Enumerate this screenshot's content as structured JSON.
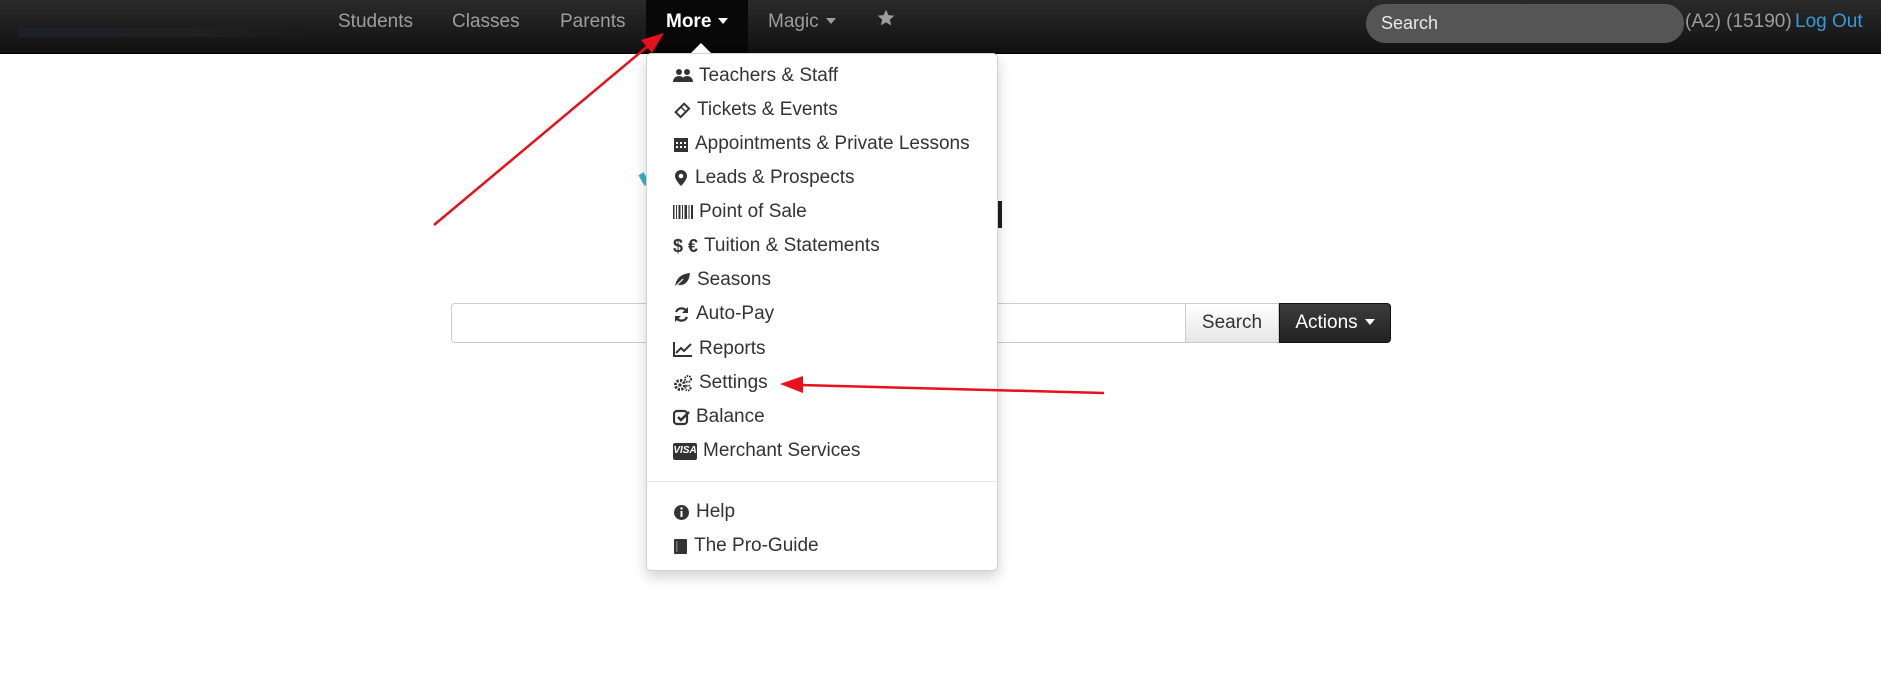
{
  "navbar": {
    "links": [
      {
        "label": "Students"
      },
      {
        "label": "Classes"
      },
      {
        "label": "Parents"
      }
    ],
    "more_label": "More",
    "magic_label": "Magic",
    "search_placeholder": "Search",
    "account_text": "(A2) (15190)",
    "logout_label": "Log Out"
  },
  "main": {
    "search_value": "",
    "search_button": "Search",
    "actions_button": "Actions"
  },
  "dropdown": {
    "items": [
      {
        "label": "Teachers & Staff",
        "icon": "users-icon"
      },
      {
        "label": "Tickets & Events",
        "icon": "ticket-icon"
      },
      {
        "label": "Appointments & Private Lessons",
        "icon": "calendar-icon"
      },
      {
        "label": "Leads & Prospects",
        "icon": "map-marker-icon"
      },
      {
        "label": "Point of Sale",
        "icon": "barcode-icon"
      },
      {
        "label": "Tuition & Statements",
        "icon": "dollar-euro-icon"
      },
      {
        "label": "Seasons",
        "icon": "leaf-icon"
      },
      {
        "label": "Auto-Pay",
        "icon": "refresh-icon"
      },
      {
        "label": "Reports",
        "icon": "line-chart-icon"
      },
      {
        "label": "Settings",
        "icon": "gears-icon"
      },
      {
        "label": "Balance",
        "icon": "check-square-icon"
      },
      {
        "label": "Merchant Services",
        "icon": "visa-card-icon"
      }
    ],
    "secondary": [
      {
        "label": "Help",
        "icon": "info-circle-icon"
      },
      {
        "label": "The Pro-Guide",
        "icon": "book-icon"
      }
    ],
    "dollar_euro_glyph": "$ €",
    "visa_text": "VISA"
  },
  "colors": {
    "navbar_bg": "#1b1b1b",
    "link": "#3a9ad9",
    "annotation_arrow": "#e8111b"
  }
}
